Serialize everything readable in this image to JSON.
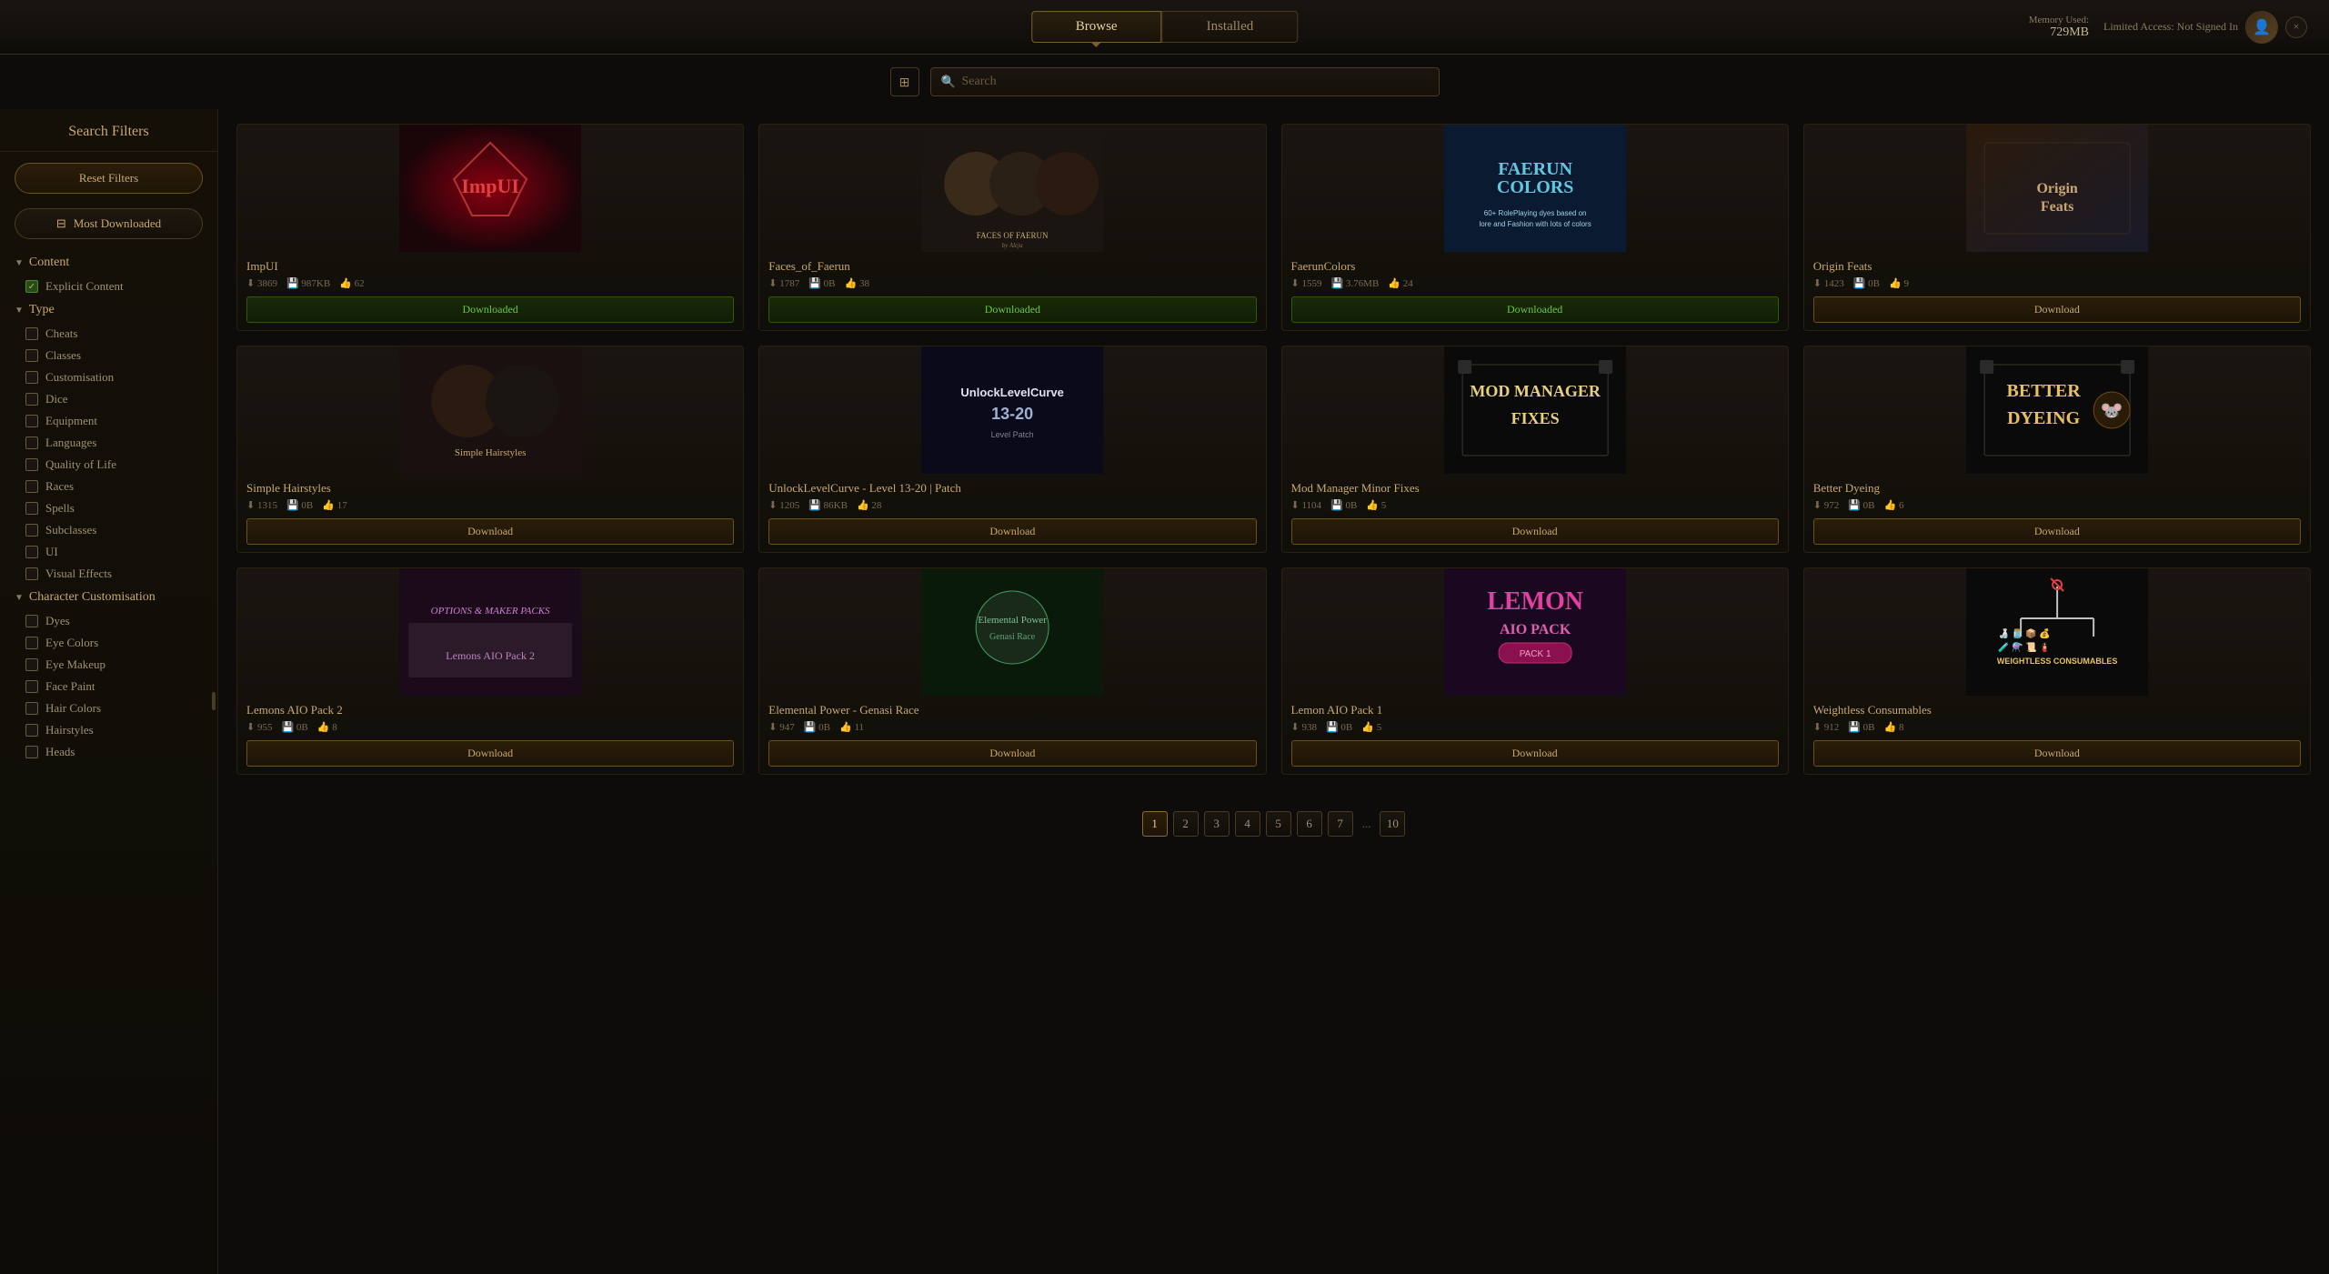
{
  "nav": {
    "tab_browse": "Browse",
    "tab_installed": "Installed",
    "memory_label": "Memory Used:",
    "memory_value": "729MB",
    "sign_in_text": "Limited Access: Not Signed In",
    "close_label": "×"
  },
  "search": {
    "placeholder": "Search",
    "sort_icon": "≡"
  },
  "sidebar": {
    "title": "Search Filters",
    "reset_label": "Reset Filters",
    "sort_label": "Most Downloaded",
    "content_section": "Content",
    "explicit_label": "Explicit Content",
    "type_section": "Type",
    "types": [
      "Cheats",
      "Classes",
      "Customisation",
      "Dice",
      "Equipment",
      "Languages",
      "Quality of Life",
      "Races",
      "Spells",
      "Subclasses",
      "UI",
      "Visual Effects"
    ],
    "char_section": "Character Customisation",
    "char_types": [
      "Dyes",
      "Eye Colors",
      "Eye Makeup",
      "Face Paint",
      "Hair Colors",
      "Hairstyles",
      "Heads"
    ]
  },
  "mods": [
    {
      "name": "ImpUI",
      "downloads": "3869",
      "size": "987KB",
      "likes": "62",
      "status": "Downloaded",
      "is_downloaded": true,
      "thumb_style": "thumb-impui",
      "thumb_text": "ImpUI",
      "thumb_color": "#c84040"
    },
    {
      "name": "Faces_of_Faerun",
      "downloads": "1787",
      "size": "0B",
      "likes": "38",
      "status": "Downloaded",
      "is_downloaded": true,
      "thumb_style": "thumb-faces",
      "thumb_text": "FACES OF FAERUN",
      "thumb_color": "#c8a870"
    },
    {
      "name": "FaerunColors",
      "downloads": "1559",
      "size": "3.76MB",
      "likes": "24",
      "status": "Downloaded",
      "is_downloaded": true,
      "thumb_style": "thumb-faerun",
      "thumb_text": "FAERUNCOLORS",
      "thumb_color": "#60c8e0"
    },
    {
      "name": "Origin Feats",
      "downloads": "1423",
      "size": "0B",
      "likes": "9",
      "status": "Download",
      "is_downloaded": false,
      "thumb_style": "thumb-origin",
      "thumb_text": "Origin Feats",
      "thumb_color": "#c8a870"
    },
    {
      "name": "Simple Hairstyles",
      "downloads": "1315",
      "size": "0B",
      "likes": "17",
      "status": "Download",
      "is_downloaded": false,
      "thumb_style": "thumb-hairstyles",
      "thumb_text": "Simple Hairstyles",
      "thumb_color": "#c8a870"
    },
    {
      "name": "UnlockLevelCurve - Level 13-20 | Patch",
      "downloads": "1205",
      "size": "86KB",
      "likes": "28",
      "status": "Download",
      "is_downloaded": false,
      "thumb_style": "thumb-unlock",
      "thumb_text": "UnlockLevelCurve",
      "thumb_color": "#a0c0e0"
    },
    {
      "name": "Mod Manager Minor Fixes",
      "downloads": "1104",
      "size": "0B",
      "likes": "5",
      "status": "Download",
      "is_downloaded": false,
      "thumb_style": "thumb-modmanager",
      "thumb_text": "MOD MANAGER FIXES",
      "thumb_color": "#e8d080"
    },
    {
      "name": "Better Dyeing",
      "downloads": "972",
      "size": "0B",
      "likes": "6",
      "status": "Download",
      "is_downloaded": false,
      "thumb_style": "thumb-better",
      "thumb_text": "BETTER DYEING",
      "thumb_color": "#e8c060"
    },
    {
      "name": "Lemons AIO Pack 2",
      "downloads": "955",
      "size": "0B",
      "likes": "8",
      "status": "Download",
      "is_downloaded": false,
      "thumb_style": "thumb-lemons",
      "thumb_text": "Lemons AIO Pack 2",
      "thumb_color": "#c080c0"
    },
    {
      "name": "Elemental Power - Genasi Race",
      "downloads": "947",
      "size": "0B",
      "likes": "11",
      "status": "Download",
      "is_downloaded": false,
      "thumb_style": "thumb-elemental",
      "thumb_text": "Elemental Power",
      "thumb_color": "#80c0e0"
    },
    {
      "name": "Lemon AIO Pack 1",
      "downloads": "938",
      "size": "0B",
      "likes": "5",
      "status": "Download",
      "is_downloaded": false,
      "thumb_style": "thumb-lemon",
      "thumb_text": "LEMON AIO PACK",
      "thumb_color": "#e040a0"
    },
    {
      "name": "Weightless Consumables",
      "downloads": "912",
      "size": "0B",
      "likes": "8",
      "status": "Download",
      "is_downloaded": false,
      "thumb_style": "thumb-weightless",
      "thumb_text": "WEIGHTLESS CONSUMABLES",
      "thumb_color": "#e8c060"
    }
  ],
  "pagination": {
    "pages": [
      "1",
      "2",
      "3",
      "4",
      "5",
      "6",
      "7",
      "...",
      "10"
    ],
    "active": "1"
  }
}
